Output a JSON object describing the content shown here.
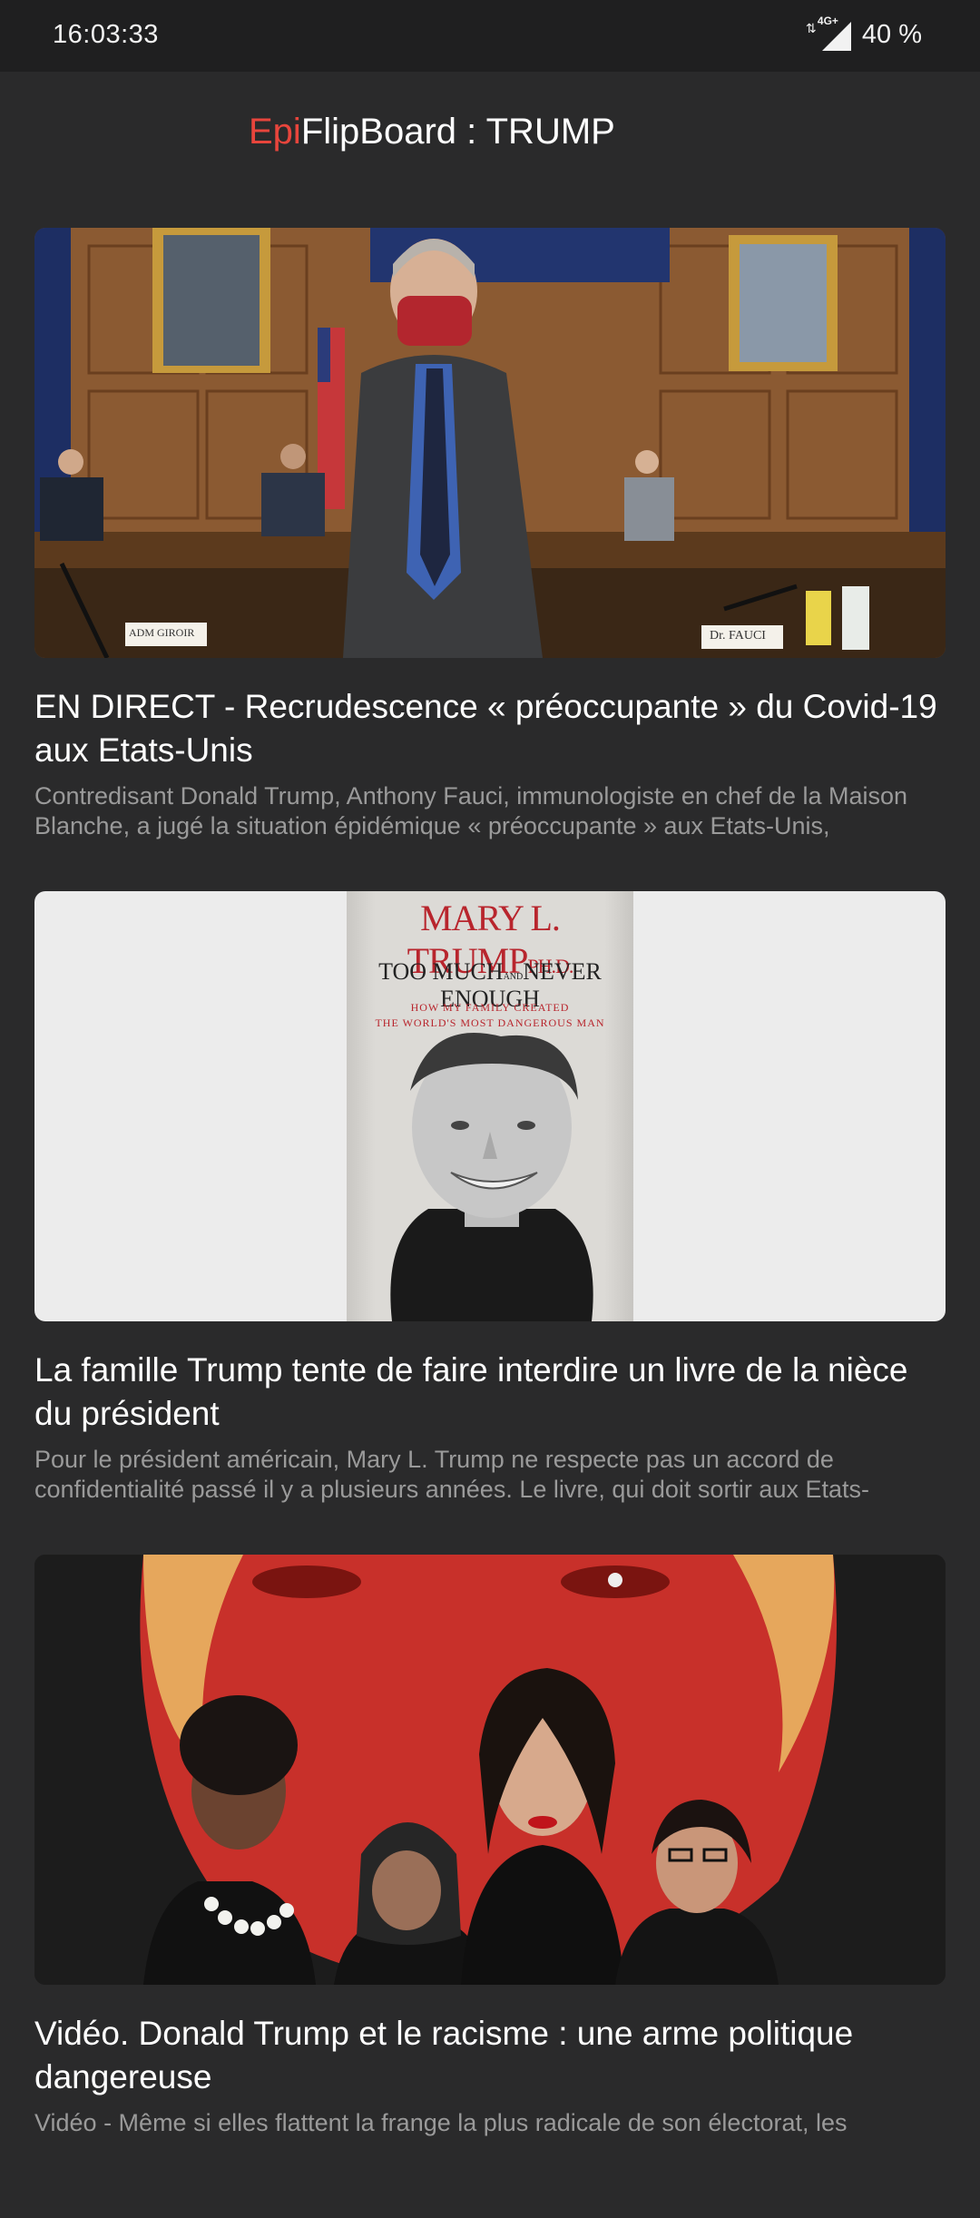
{
  "status_bar": {
    "time": "16:03:33",
    "network": "4G+",
    "battery": "40 %"
  },
  "header": {
    "title_accent": "Epi",
    "title_rest": "FlipBoard : TRUMP",
    "accent_color": "#e8453c"
  },
  "articles": [
    {
      "image": {
        "desc": "photo-hearing-room",
        "labels": [
          "ADM GIROIR",
          "Dr. FAUCI"
        ]
      },
      "title": "EN DIRECT - Recrudescence « préoccupante » du Covid-19 aux Etats-Unis",
      "summary": "Contredisant Donald Trump, Anthony Fauci, immunologiste en chef de la Maison Blanche, a jugé la situation épidémique « préoccupante » aux Etats-Unis,"
    },
    {
      "image": {
        "desc": "book-cover",
        "author": "MARY L. TRUMP",
        "author_suffix": "PH.D.",
        "book_title_a": "TOO MUCH",
        "book_title_and": "AND",
        "book_title_b": "NEVER ENOUGH",
        "subtitle_1": "HOW MY FAMILY CREATED",
        "subtitle_2": "THE WORLD'S MOST DANGEROUS MAN"
      },
      "title": "La famille Trump tente de faire interdire un livre de la nièce du président",
      "summary": "Pour le président américain, Mary L. Trump ne respecte pas un accord de confidentialité passé il y a plusieurs années. Le livre, qui doit sortir aux Etats-"
    },
    {
      "image": {
        "desc": "red-illustration"
      },
      "title": "Vidéo. Donald Trump et le racisme : une arme politique dangereuse",
      "summary": "Vidéo - Même si elles flattent la frange la plus radicale de son électorat, les"
    }
  ]
}
